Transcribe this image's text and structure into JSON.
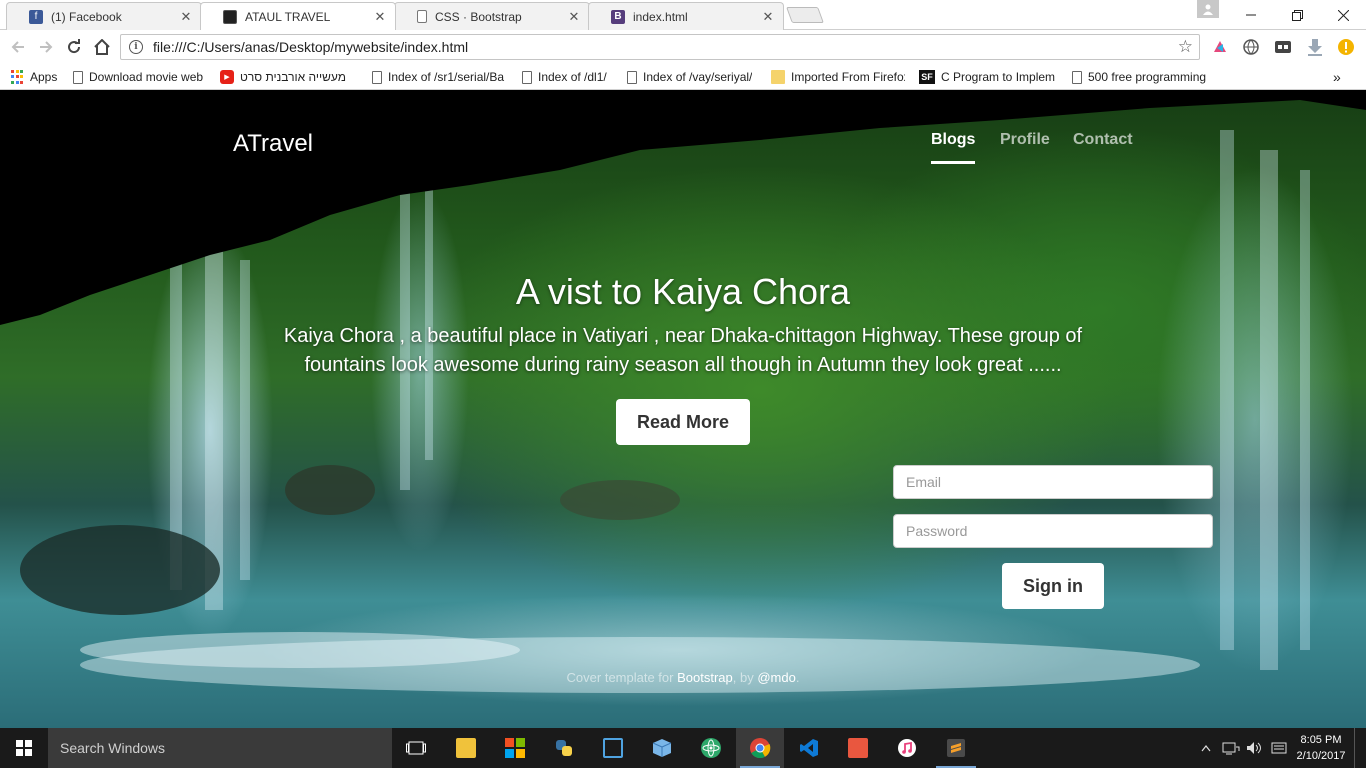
{
  "browser": {
    "tabs": [
      {
        "title": "(1) Facebook",
        "icon": "facebook-icon",
        "color": "#3b5998",
        "glyph": "f"
      },
      {
        "title": "ATAUL TRAVEL",
        "icon": "site-icon",
        "color": "#222222",
        "glyph": ""
      },
      {
        "title": "CSS · Bootstrap",
        "icon": "page-icon",
        "color": "#ffffff",
        "glyph": ""
      },
      {
        "title": "index.html",
        "icon": "bootstrap-icon",
        "color": "#563d7c",
        "glyph": "B"
      }
    ],
    "close_glyph": "✕",
    "url": "file:///C:/Users/anas/Desktop/mywebsite/index.html",
    "bookmarks": [
      {
        "label": "Apps",
        "icon": "apps-icon"
      },
      {
        "label": "Download movie web",
        "icon": "page-icon"
      },
      {
        "label": "מעשייה אורבנית סרט",
        "icon": "youtube-icon"
      },
      {
        "label": "Index of /sr1/serial/Ba",
        "icon": "page-icon"
      },
      {
        "label": "Index of /dl1/",
        "icon": "page-icon"
      },
      {
        "label": "Index of /vay/seriyal/",
        "icon": "page-icon"
      },
      {
        "label": "Imported From Firefox",
        "icon": "folder-icon"
      },
      {
        "label": "C Program to Implem",
        "icon": "sf-icon"
      },
      {
        "label": "500 free programming",
        "icon": "page-icon"
      }
    ],
    "more_glyph": "»"
  },
  "site": {
    "brand": "ATravel",
    "nav": [
      {
        "label": "Blogs",
        "active": true
      },
      {
        "label": "Profile",
        "active": false
      },
      {
        "label": "Contact",
        "active": false
      }
    ],
    "hero": {
      "title": "A vist to Kaiya Chora",
      "lead": "Kaiya Chora , a beautiful place in Vatiyari , near Dhaka-chittagon Highway. These group of fountains look awesome during rainy season all though in Autumn they look great ......",
      "button": "Read More"
    },
    "form": {
      "email_placeholder": "Email",
      "password_placeholder": "Password",
      "submit": "Sign in"
    },
    "footer": {
      "prefix": "Cover template for ",
      "link1": "Bootstrap",
      "middle": ", by ",
      "link2": "@mdo",
      "suffix": "."
    }
  },
  "taskbar": {
    "search_placeholder": "Search Windows",
    "apps": [
      "task-view-icon",
      "file-explorer-icon",
      "office-icon",
      "python-icon",
      "frame-icon",
      "box-icon",
      "atom-icon",
      "chrome-icon",
      "visual-studio-icon",
      "media-icon",
      "itunes-icon",
      "sublime-icon"
    ],
    "time": "8:05 PM",
    "date": "2/10/2017"
  },
  "colors": {
    "taskbar": "#1a1a1a",
    "chrome_accent": "#4285f4"
  }
}
